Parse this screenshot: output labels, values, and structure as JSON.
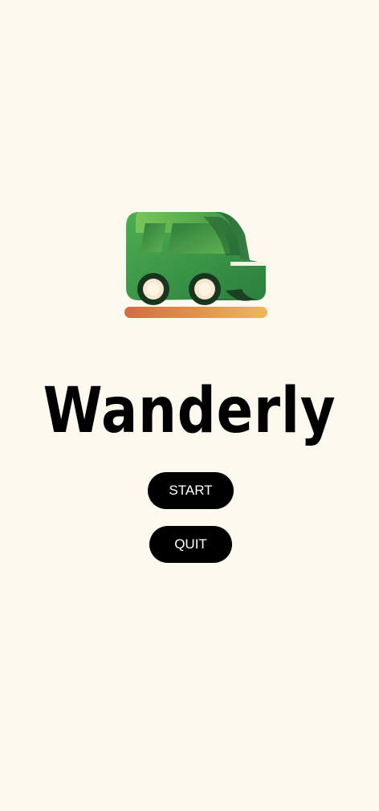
{
  "app": {
    "title": "Wanderly",
    "logo_icon": "car-icon"
  },
  "menu": {
    "start_label": "START",
    "quit_label": "QUIT"
  },
  "colors": {
    "background": "#fef9ee",
    "button_bg": "#000000",
    "button_text": "#ffffff",
    "car_body": "#3d9f49",
    "car_roof": "#7cc356",
    "road_start": "#d56b42",
    "road_end": "#ecb95a"
  }
}
